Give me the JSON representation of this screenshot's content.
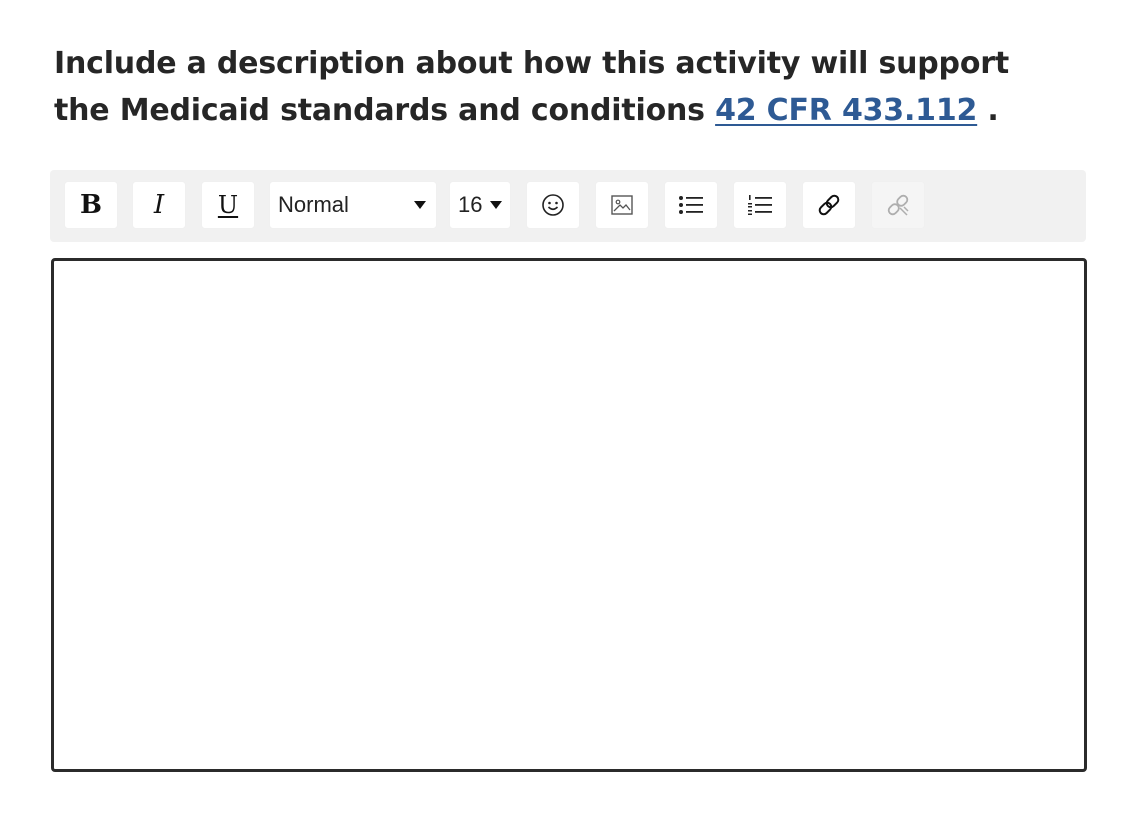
{
  "prompt": {
    "line1": "Include a description about how this activity will support",
    "line2_prefix": "the Medicaid standards and conditions ",
    "link_text": "42 CFR 433.112",
    "suffix": " ."
  },
  "toolbar": {
    "bold_label": "B",
    "italic_label": "I",
    "underline_label": "U",
    "block_type": {
      "selected": "Normal"
    },
    "font_size": {
      "selected": "16"
    },
    "icons": {
      "emoji": "emoji-icon",
      "image": "image-icon",
      "unordered_list": "unordered-list-icon",
      "ordered_list": "ordered-list-icon",
      "link": "link-icon",
      "unlink": "unlink-icon"
    }
  },
  "editor": {
    "value": ""
  },
  "colors": {
    "link": "#2e5a94",
    "toolbar_bg": "#f1f1f1",
    "editor_border": "#2b2b2b",
    "text": "#262626"
  }
}
